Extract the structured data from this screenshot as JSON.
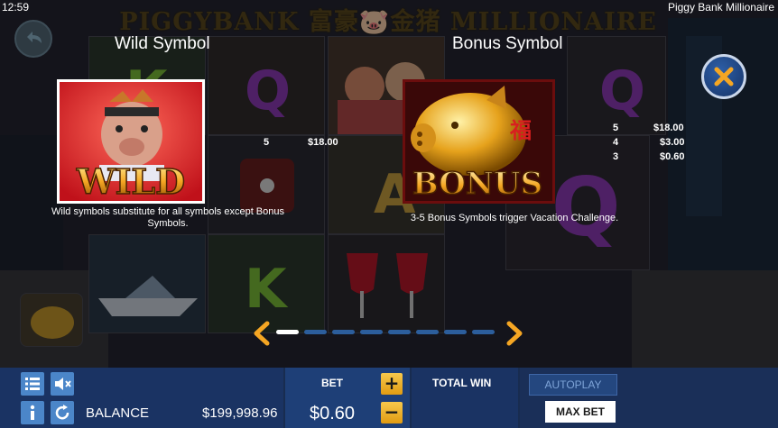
{
  "status": {
    "time": "12:59",
    "game_name": "Piggy Bank Millionaire"
  },
  "banner": {
    "title": "PIGGYBANK 富豪🐷金猪 MILLIONAIRE"
  },
  "paytable": {
    "wild": {
      "heading": "Wild Symbol",
      "card_text": "WILD",
      "description": "Wild symbols substitute for all symbols except Bonus Symbols."
    },
    "bonus": {
      "heading": "Bonus Symbol",
      "card_text": "BONUS",
      "description": "3-5 Bonus Symbols trigger Vacation Challenge."
    },
    "left_payout": {
      "count": "5",
      "value": "$18.00"
    },
    "right_payouts": [
      {
        "count": "5",
        "value": "$18.00"
      },
      {
        "count": "4",
        "value": "$3.00"
      },
      {
        "count": "3",
        "value": "$0.60"
      }
    ],
    "pager": {
      "total_pages": 8,
      "current_page": 1
    }
  },
  "controls": {
    "balance_label": "BALANCE",
    "balance_value": "$199,998.96",
    "bet_label": "BET",
    "bet_value": "$0.60",
    "plus": "+",
    "minus": "−",
    "total_win_label": "TOTAL WIN",
    "autoplay_label": "AUTOPLAY",
    "max_bet_label": "MAX BET"
  },
  "colors": {
    "accent_gold": "#f5a623",
    "panel_blue": "#1a3363",
    "close_blue": "#1f4b8f"
  }
}
